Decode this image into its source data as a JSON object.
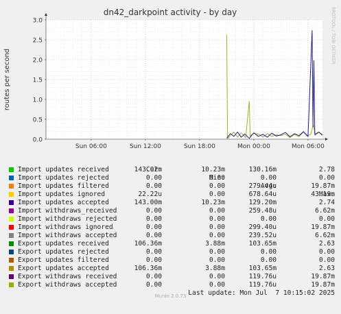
{
  "chart_data": {
    "type": "line",
    "title": "dn42_darkpoint activity - by day",
    "ylabel": "routes per second",
    "side_label": "RRDTOOL / TOBI OETIKER",
    "ylim": [
      0,
      3.0
    ],
    "y_ticks": [
      "0.0",
      "0.5",
      "1.0",
      "1.5",
      "2.0",
      "2.5",
      "3.0"
    ],
    "x_ticks": [
      "Sun 06:00",
      "Sun 12:00",
      "Sun 18:00",
      "Mon 00:00",
      "Mon 06:00"
    ],
    "x_range_hours": [
      0,
      30.6
    ],
    "x_tick_hours": [
      5.0,
      11.0,
      17.0,
      23.0,
      29.0
    ],
    "grid": true,
    "series": [
      {
        "name": "Export withdraws accepted",
        "color": "#99b81f",
        "values_start_hour": 20.0,
        "step_hours": 0.1,
        "points": [
          [
            20.0,
            2.63
          ],
          [
            20.1,
            0.02
          ],
          [
            20.8,
            0.18
          ],
          [
            21.2,
            0.05
          ],
          [
            21.6,
            0.16
          ],
          [
            22.1,
            0.04
          ],
          [
            22.5,
            0.96
          ],
          [
            22.6,
            0.08
          ],
          [
            23.0,
            0.15
          ],
          [
            23.6,
            0.12
          ],
          [
            24.0,
            0.05
          ],
          [
            24.5,
            0.14
          ],
          [
            25.0,
            0.07
          ],
          [
            25.5,
            0.11
          ],
          [
            26.0,
            0.09
          ],
          [
            26.5,
            0.13
          ],
          [
            27.0,
            0.04
          ],
          [
            27.5,
            0.12
          ],
          [
            28.0,
            0.06
          ],
          [
            28.5,
            0.18
          ],
          [
            28.9,
            0.08
          ],
          [
            29.3,
            0.12
          ],
          [
            29.6,
            0.37
          ],
          [
            29.8,
            0.1
          ],
          [
            30.2,
            0.17
          ],
          [
            30.6,
            0.12
          ]
        ]
      },
      {
        "name": "Import updates accepted",
        "color": "#1c1c9c",
        "points": [
          [
            20.0,
            0.02
          ],
          [
            20.4,
            0.14
          ],
          [
            20.8,
            0.07
          ],
          [
            21.2,
            0.18
          ],
          [
            21.6,
            0.05
          ],
          [
            22.0,
            0.13
          ],
          [
            22.5,
            0.02
          ],
          [
            23.0,
            0.16
          ],
          [
            23.5,
            0.07
          ],
          [
            24.0,
            0.12
          ],
          [
            24.5,
            0.05
          ],
          [
            25.0,
            0.15
          ],
          [
            25.5,
            0.08
          ],
          [
            26.0,
            0.11
          ],
          [
            26.5,
            0.17
          ],
          [
            27.0,
            0.06
          ],
          [
            27.5,
            0.14
          ],
          [
            28.0,
            0.09
          ],
          [
            28.5,
            0.19
          ],
          [
            29.0,
            0.07
          ],
          [
            29.45,
            2.74
          ],
          [
            29.55,
            0.3
          ],
          [
            29.65,
            1.98
          ],
          [
            29.75,
            0.12
          ],
          [
            30.2,
            0.18
          ],
          [
            30.6,
            0.1
          ]
        ]
      }
    ]
  },
  "legend": {
    "headers": [
      "Cur:",
      "Min:",
      "Avg:",
      "Max:"
    ],
    "rows": [
      {
        "name": "Import updates received",
        "color": "#00cc00",
        "cur": "143.02m",
        "min": "10.23m",
        "avg": "130.16m",
        "max": "2.78"
      },
      {
        "name": "Import updates rejected",
        "color": "#0066b3",
        "cur": "0.00",
        "min": "0.00",
        "avg": "0.00",
        "max": "0.00"
      },
      {
        "name": "Import updates filtered",
        "color": "#ff8000",
        "cur": "0.00",
        "min": "0.00",
        "avg": "279.44u",
        "max": "19.87m"
      },
      {
        "name": "Import updates ignored",
        "color": "#ffcc00",
        "cur": "22.22u",
        "min": "0.00",
        "avg": "678.64u",
        "max": "43.19m"
      },
      {
        "name": "Import updates accepted",
        "color": "#330099",
        "cur": "143.00m",
        "min": "10.23m",
        "avg": "129.20m",
        "max": "2.74"
      },
      {
        "name": "Import withdraws_received",
        "color": "#990099",
        "cur": "0.00",
        "min": "0.00",
        "avg": "259.48u",
        "max": "6.62m"
      },
      {
        "name": "Import withdraws rejected",
        "color": "#ccff00",
        "cur": "0.00",
        "min": "0.00",
        "avg": "0.00",
        "max": "0.00"
      },
      {
        "name": "Import withdraws ignored",
        "color": "#ff0000",
        "cur": "0.00",
        "min": "0.00",
        "avg": "299.40u",
        "max": "19.87m"
      },
      {
        "name": "Import withdraws accepted",
        "color": "#808080",
        "cur": "0.00",
        "min": "0.00",
        "avg": "239.52u",
        "max": "6.62m"
      },
      {
        "name": "Export updates received",
        "color": "#008f00",
        "cur": "106.36m",
        "min": "3.88m",
        "avg": "103.65m",
        "max": "2.63"
      },
      {
        "name": "Export updates rejected",
        "color": "#00487d",
        "cur": "0.00",
        "min": "0.00",
        "avg": "0.00",
        "max": "0.00"
      },
      {
        "name": "Export updates filtered",
        "color": "#b35a00",
        "cur": "0.00",
        "min": "0.00",
        "avg": "0.00",
        "max": "0.00"
      },
      {
        "name": "Export updates accepted",
        "color": "#b38f00",
        "cur": "106.36m",
        "min": "3.88m",
        "avg": "103.65m",
        "max": "2.63"
      },
      {
        "name": "Export withdraws received",
        "color": "#6b006b",
        "cur": "0.00",
        "min": "0.00",
        "avg": "119.76u",
        "max": "19.87m"
      },
      {
        "name": "Export withdraws accepted",
        "color": "#8fb300",
        "cur": "0.00",
        "min": "0.00",
        "avg": "119.76u",
        "max": "19.87m"
      }
    ],
    "last_update": "Last update: Mon Jul  7 10:15:02 2025"
  },
  "footer": "Munin 2.0.73"
}
